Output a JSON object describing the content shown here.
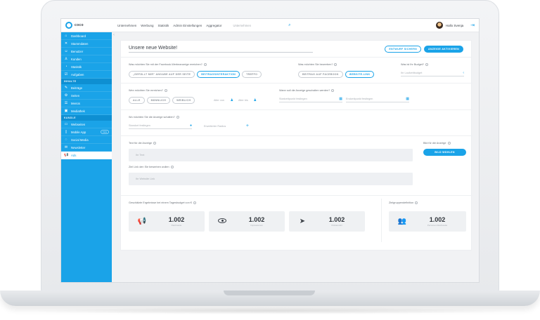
{
  "brand": {
    "logo_text": "coco"
  },
  "topbar": {
    "nav": [
      "Unternehmen",
      "Werbung",
      "Statistik",
      "Admin Einstellungen",
      "Aggregator"
    ],
    "search_placeholder": "Unternehmen",
    "greeting": "Hallo Svenja"
  },
  "sidebar": {
    "items_top": [
      {
        "label": "Dashboard",
        "icon": "home-icon",
        "glyph": "⌂"
      },
      {
        "label": "Stammdaten",
        "icon": "tools-icon",
        "glyph": "✕"
      },
      {
        "label": "Benutzer",
        "icon": "user-icon",
        "glyph": "☺"
      },
      {
        "label": "Kunden",
        "icon": "person-icon",
        "glyph": "♙"
      },
      {
        "label": "Statistik",
        "icon": "chart-icon",
        "glyph": "◔"
      },
      {
        "label": "Aufgaben",
        "icon": "check-icon",
        "glyph": "☑"
      }
    ],
    "section_inhalte": "INHALTE",
    "items_inhalte": [
      {
        "label": "Beiträge",
        "icon": "edit-icon",
        "glyph": "✎"
      },
      {
        "label": "Seiten",
        "icon": "gear-icon",
        "glyph": "⚙"
      },
      {
        "label": "Menüs",
        "icon": "menu-icon",
        "glyph": "☰"
      },
      {
        "label": "Mediathek",
        "icon": "media-icon",
        "glyph": "▣"
      }
    ],
    "section_kanaele": "KANÄLE",
    "items_kanaele": [
      {
        "label": "Webseiten",
        "icon": "monitor-icon",
        "glyph": "▭",
        "badge": ""
      },
      {
        "label": "Mobile App",
        "icon": "phone-icon",
        "glyph": "▯",
        "badge": "beta"
      },
      {
        "label": "Social Media",
        "icon": "chat-icon",
        "glyph": "◌",
        "badge": ""
      },
      {
        "label": "Newsletter",
        "icon": "mail-icon",
        "glyph": "✉",
        "badge": ""
      },
      {
        "label": "Ads",
        "icon": "megaphone-icon",
        "glyph": "📢",
        "badge": ""
      }
    ]
  },
  "form": {
    "title": "Unsere neue Website!",
    "btn_save": "ENTWURF SICHERN",
    "btn_activate": "ANZEIGE AKTIVIEREN",
    "goal_label": "Was möchten Sie mit der Facebook-Werbeanzeige erreichen?",
    "goal_options": [
      "„GEFÄLLT MIR\" ANGABE AUF DER SEITE",
      "BEITRAGSINTERAKTION",
      "TREFFO"
    ],
    "promote_label": "Was möchten Sie bewerben?",
    "promote_options": [
      "BEITRAG AUF FACEBOOK",
      "WEBSITE-LINK"
    ],
    "budget_label": "Was ist Ihr Budget?",
    "budget_placeholder": "Ihr Laufzeitbudget",
    "audience_label": "Wen möchten Sie erreichen?",
    "audience_options": [
      "ALLE",
      "MÄNNLICH",
      "WEIBLICH"
    ],
    "age_from": "Alter von",
    "age_to": "Alter bis",
    "when_label": "Wann soll die Anzeige geschalten werden?",
    "start_placeholder": "Startzeitpunkt festlegen",
    "end_placeholder": "Endzeitpunkt festlegen",
    "where_label": "Wo möchten Sie die Anzeige schalten?",
    "location_placeholder": "Standort festlegen",
    "radius_placeholder": "Erweiterter Radius",
    "text_label": "Text für die Anzeige",
    "text_placeholder": "Ihr Text",
    "link_label": "Ziel Link den Sie bewerben wollen",
    "link_placeholder": "Ihr Website Link",
    "image_label": "Bild für die Anzeige",
    "btn_image": "BILD WÄHLEN",
    "results_label": "Geschätzte Ergebnisse bei einem Tagesbudget von €",
    "target_label": "Zielgruppendefinition"
  },
  "stats": [
    {
      "value": "1.002",
      "caption": "Reichweite",
      "icon": "megaphone-icon"
    },
    {
      "value": "1.002",
      "caption": "Impressionen",
      "icon": "eye-icon"
    },
    {
      "value": "1.002",
      "caption": "Klickanzahl",
      "icon": "cursor-icon"
    },
    {
      "value": "1.002",
      "caption": "Personen Reichweite",
      "icon": "group-icon"
    }
  ],
  "colors": {
    "accent": "#1aa3e8"
  }
}
